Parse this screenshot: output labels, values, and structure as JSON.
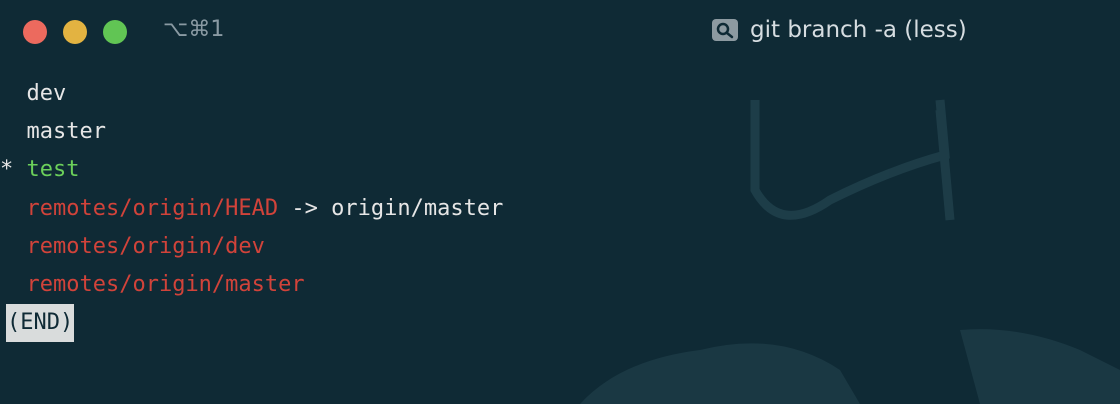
{
  "window": {
    "shortcut": "⌥⌘1",
    "title": "git branch -a (less)"
  },
  "branches": [
    {
      "marker": " ",
      "name": "dev",
      "type": "local"
    },
    {
      "marker": " ",
      "name": "master",
      "type": "local"
    },
    {
      "marker": "*",
      "name": "test",
      "type": "current"
    },
    {
      "marker": " ",
      "name": "remotes/origin/HEAD",
      "type": "remote",
      "suffix": " -> origin/master"
    },
    {
      "marker": " ",
      "name": "remotes/origin/dev",
      "type": "remote"
    },
    {
      "marker": " ",
      "name": "remotes/origin/master",
      "type": "remote"
    }
  ],
  "pager_status": "(END)",
  "colors": {
    "background": "#0f2a35",
    "current_branch": "#6bcf5a",
    "remote_branch": "#d1433a",
    "text": "#e6e6e6",
    "end_highlight": "#d9dcdc"
  }
}
